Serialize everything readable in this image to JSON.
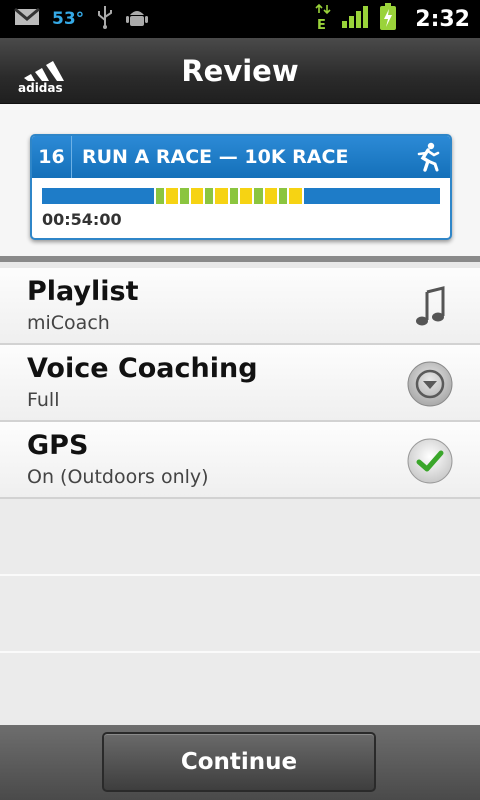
{
  "status_bar": {
    "temperature": "53°",
    "time": "2:32",
    "network_type": "E",
    "icons": [
      "gmail-icon",
      "usb-icon",
      "android-debug-icon",
      "data-arrows-icon",
      "signal-icon",
      "battery-charging-icon"
    ]
  },
  "header": {
    "title": "Review",
    "logo": "adidas",
    "background": "#2b2b2b"
  },
  "workout": {
    "number": "16",
    "title": "RUN A RACE — 10K RACE",
    "duration": "00:54:00",
    "accent": "#1e7cc8",
    "zone_colors": {
      "blue": "#1e7cc8",
      "green": "#8bc53f",
      "yellow": "#f6d313"
    },
    "segments": [
      {
        "zone": "blue",
        "weight": 27
      },
      {
        "zone": "green",
        "weight": 2
      },
      {
        "zone": "yellow",
        "weight": 3
      },
      {
        "zone": "green",
        "weight": 2
      },
      {
        "zone": "yellow",
        "weight": 3
      },
      {
        "zone": "green",
        "weight": 2
      },
      {
        "zone": "yellow",
        "weight": 3
      },
      {
        "zone": "green",
        "weight": 2
      },
      {
        "zone": "yellow",
        "weight": 3
      },
      {
        "zone": "green",
        "weight": 2
      },
      {
        "zone": "yellow",
        "weight": 3
      },
      {
        "zone": "green",
        "weight": 2
      },
      {
        "zone": "yellow",
        "weight": 3
      },
      {
        "zone": "blue",
        "weight": 33
      }
    ]
  },
  "settings": [
    {
      "title": "Playlist",
      "value": "miCoach",
      "icon": "music-note-icon"
    },
    {
      "title": "Voice Coaching",
      "value": "Full",
      "icon": "dropdown-arrow-icon"
    },
    {
      "title": "GPS",
      "value": "On (Outdoors only)",
      "icon": "checkmark-icon"
    }
  ],
  "footer": {
    "continue_label": "Continue"
  }
}
